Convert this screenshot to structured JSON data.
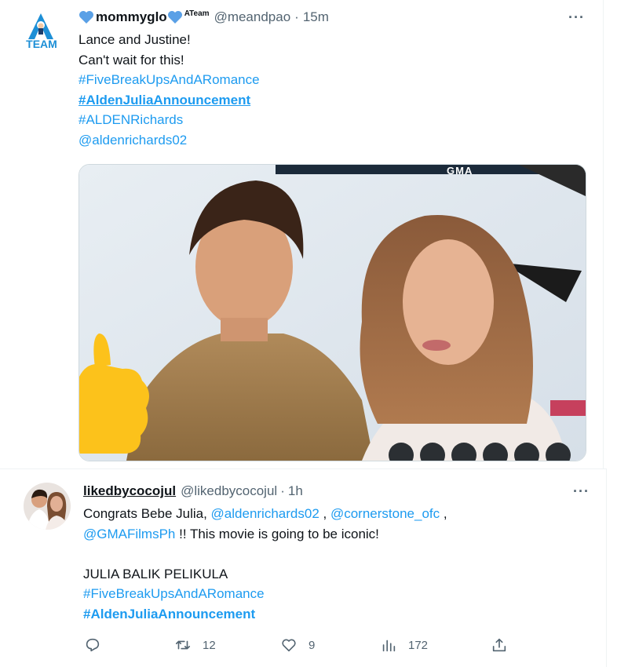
{
  "tweet1": {
    "display_name": "mommyglo",
    "badge": "ATeam",
    "handle": "@meandpao",
    "dot": "·",
    "time": "15m",
    "avatar_label": "TEAM",
    "more": "···",
    "lines": [
      {
        "text": "Lance and Justine!",
        "kind": "text"
      },
      {
        "text": "Can't wait for this!",
        "kind": "text"
      },
      {
        "text": "#FiveBreakUpsAndARomance",
        "kind": "link"
      },
      {
        "text": "#AldenJuliaAnnouncement",
        "kind": "link-bold"
      },
      {
        "text": "#ALDENRichards",
        "kind": "link"
      },
      {
        "text": "@aldenrichards02",
        "kind": "link"
      }
    ],
    "media_overlay_text": "GMA"
  },
  "tweet2": {
    "display_name": "likedbycocojul",
    "handle": "@likedbycocojul",
    "dot": "·",
    "time": "1h",
    "more": "···",
    "line1_prefix": "Congrats Bebe Julia, ",
    "mention1": "@aldenrichards02",
    "sep1": " , ",
    "mention2": "@cornerstone_ofc",
    "sep2": " ,",
    "mention3": "@GMAFilmsPh",
    "line2_suffix": " !! This movie is going to be iconic!",
    "line3": "JULIA BALIK PELIKULA",
    "hashtag1": "#FiveBreakUpsAndARomance",
    "hashtag2": "#AldenJuliaAnnouncement",
    "actions": {
      "reply_count": "",
      "retweet_count": "12",
      "like_count": "9",
      "views_count": "172"
    }
  },
  "colors": {
    "link": "#1d9bf0",
    "muted": "#536471",
    "heart": "#5aa0e6"
  }
}
